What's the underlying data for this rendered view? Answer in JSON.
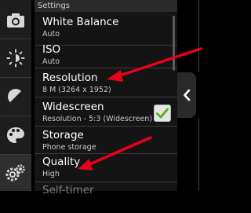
{
  "panel": {
    "header": "Settings",
    "items": [
      {
        "title": "White Balance",
        "value": "Auto"
      },
      {
        "title": "ISO",
        "value": "Auto"
      },
      {
        "title": "Resolution",
        "value": "8 M (3264 x 1952)"
      },
      {
        "title": "Widescreen",
        "value": "Resolution - 5:3 (Widescreen)",
        "checked": true
      },
      {
        "title": "Storage",
        "value": "Phone storage"
      },
      {
        "title": "Quality",
        "value": "High"
      },
      {
        "title": "Self-timer",
        "value": ""
      }
    ]
  },
  "toolbar": {
    "icons": [
      "camera-icon",
      "brightness-icon",
      "exposure-icon",
      "palette-icon",
      "settings-gears-icon"
    ],
    "active": "settings-gears-icon"
  },
  "colors": {
    "arrow": "#e8001c",
    "panel_bg": "#141414",
    "toolbar_bg": "#1d1d1d",
    "checkbox_check": "#5cb02c"
  }
}
